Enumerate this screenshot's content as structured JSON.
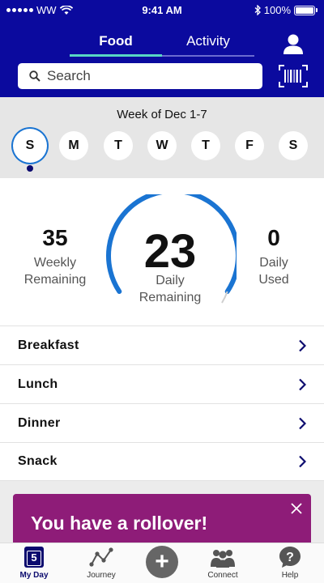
{
  "status_bar": {
    "carrier": "WW",
    "time": "9:41 AM",
    "battery": "100%"
  },
  "header": {
    "tabs": [
      {
        "label": "Food",
        "active": true
      },
      {
        "label": "Activity",
        "active": false
      }
    ],
    "search": {
      "placeholder": "Search"
    }
  },
  "week": {
    "title": "Week of Dec 1-7",
    "days": [
      {
        "letter": "S",
        "selected": true
      },
      {
        "letter": "M"
      },
      {
        "letter": "T"
      },
      {
        "letter": "W"
      },
      {
        "letter": "T"
      },
      {
        "letter": "F"
      },
      {
        "letter": "S"
      }
    ]
  },
  "points": {
    "weekly": {
      "value": "35",
      "label_line1": "Weekly",
      "label_line2": "Remaining"
    },
    "daily": {
      "value": "23",
      "label_line1": "Daily",
      "label_line2": "Remaining"
    },
    "used": {
      "value": "0",
      "label_line1": "Daily",
      "label_line2": "Used"
    }
  },
  "meals": [
    {
      "label": "Breakfast"
    },
    {
      "label": "Lunch"
    },
    {
      "label": "Dinner"
    },
    {
      "label": "Snack"
    }
  ],
  "banner": {
    "text": "You have a rollover!"
  },
  "nav": {
    "items": [
      {
        "label": "My Day",
        "icon": "calendar-icon",
        "badge": "5",
        "active": true
      },
      {
        "label": "Journey",
        "icon": "journey-icon"
      },
      {
        "label": "",
        "icon": "plus-icon"
      },
      {
        "label": "Connect",
        "icon": "people-icon"
      },
      {
        "label": "Help",
        "icon": "help-icon"
      }
    ]
  },
  "colors": {
    "header": "#0b0a9e",
    "accent_teal": "#58d6c4",
    "gauge_blue": "#1a74d2",
    "banner": "#8e1c78"
  }
}
